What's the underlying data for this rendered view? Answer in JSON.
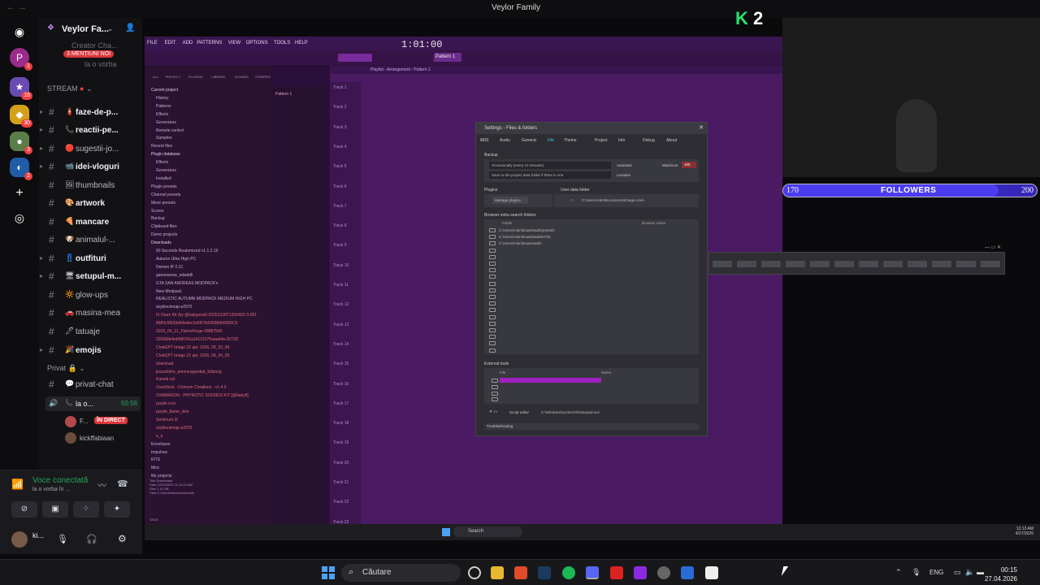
{
  "window": {
    "title": "Veylor Family",
    "nav": "← →"
  },
  "rail": {
    "badges": [
      "1",
      "16",
      "30",
      "3",
      "2"
    ]
  },
  "server": {
    "name": "Veylor Fa...",
    "mention_banner": "3 MENȚIUNI NOI",
    "hidden_top": [
      "Creator Cha...",
      "la o vorba"
    ]
  },
  "categories": {
    "stream": "STREAM",
    "private": "Privat"
  },
  "channels": [
    {
      "name": "faze-de-p...",
      "emoji": "🧯",
      "bold": true
    },
    {
      "name": "reactii-pe...",
      "emoji": "📞",
      "bold": true
    },
    {
      "name": "sugestii-jo...",
      "emoji": "🔴",
      "bold": false
    },
    {
      "name": "idei-vloguri",
      "emoji": "📹",
      "bold": true
    },
    {
      "name": "thumbnails",
      "emoji": "🖼",
      "bold": false
    },
    {
      "name": "artwork",
      "emoji": "🎨",
      "bold": true
    },
    {
      "name": "mancare",
      "emoji": "🍕",
      "bold": true
    },
    {
      "name": "animalul-...",
      "emoji": "🐶",
      "bold": false
    },
    {
      "name": "outfituri",
      "emoji": "👖",
      "bold": true
    },
    {
      "name": "setupul-m...",
      "emoji": "🖥",
      "bold": true
    },
    {
      "name": "glow-ups",
      "emoji": "🔆",
      "bold": false
    },
    {
      "name": "masina-mea",
      "emoji": "🚗",
      "bold": false
    },
    {
      "name": "tatuaje",
      "emoji": "🖊",
      "bold": false
    },
    {
      "name": "emojis",
      "emoji": "🎉",
      "bold": true
    }
  ],
  "private_channels": [
    {
      "name": "privat-chat",
      "emoji": "💬"
    },
    {
      "name": "la o...",
      "emoji": "📞",
      "time": "50:56"
    }
  ],
  "voice_users": [
    {
      "name": "F...",
      "badge": "ÎN DIRECT"
    },
    {
      "name": "kickffabiaan"
    }
  ],
  "voice_panel": {
    "status": "Voce conectată",
    "channel": "la o vorba în ...",
    "user": "ki..."
  },
  "fl": {
    "menu": [
      "FILE",
      "EDIT",
      "ADD",
      "PATTERNS",
      "VIEW",
      "OPTIONS",
      "TOOLS",
      "HELP"
    ],
    "time": "1:01:00",
    "pattern": "Pattern 1",
    "browser_tabs": [
      "ALL",
      "PROJECT",
      "PLUGINS",
      "LIBRARY",
      "SOUNDS",
      "STARRED"
    ],
    "browser_items": [
      {
        "t": "Current project",
        "sel": true
      },
      {
        "t": "History"
      },
      {
        "t": "Patterns"
      },
      {
        "t": "Effects"
      },
      {
        "t": "Generators"
      },
      {
        "t": "Remote control"
      },
      {
        "t": "Samples"
      },
      {
        "t": "Recent files"
      },
      {
        "t": "Plugin database",
        "sel": true
      },
      {
        "t": "Effects"
      },
      {
        "t": "Generators"
      },
      {
        "t": "Installed"
      },
      {
        "t": "Plugin presets"
      },
      {
        "t": "Channel presets"
      },
      {
        "t": "Mixer presets"
      },
      {
        "t": "Scores"
      },
      {
        "t": "Backup"
      },
      {
        "t": "Clipboard files"
      },
      {
        "t": "Demo projects"
      },
      {
        "t": "Downloads",
        "sel": true
      },
      {
        "t": "60 Seconds Reatomized v1.1.2.16"
      },
      {
        "t": "Autumn Ultra High PC"
      },
      {
        "t": "Demon IP 2.21"
      },
      {
        "t": "gamesense_sdwddll"
      },
      {
        "t": "GTA SAN ANDREAS MODPACK's"
      },
      {
        "t": "New Modpack"
      },
      {
        "t": "REALISTIC AUTUMN MODPACK MEDIUM HIGH PC"
      },
      {
        "t": "skyblockmap-e2970"
      },
      {
        "t": "IX Drum Kit (by @babyprod)-20251228T125040Z-3-001",
        "red": true
      },
      {
        "t": "8989c5fb39d49edec1b6f07b4369b5b5665C5",
        "red": true
      },
      {
        "t": "2026_04_21_FlameForge-28887560",
        "red": true
      },
      {
        "t": "32668defed486741a14121975aaad4a-2572D",
        "red": true
      },
      {
        "t": "ChatGPT Image 22 apr. 2026, 09_33_49",
        "red": true
      },
      {
        "t": "ChatGPT Image 22 apr. 2026, 09_34_59",
        "red": true
      },
      {
        "t": "download",
        "red": true
      },
      {
        "t": "jesusdisho_amoneyigeebat_fullsong",
        "red": true
      },
      {
        "t": "Kaneki cal",
        "red": true
      },
      {
        "t": "Overblock - Crimson Creations - v1.4.3",
        "red": true
      },
      {
        "t": "OXAMASON - PHYNOTIC SOUNDS KIT [@babyfi]",
        "red": true
      },
      {
        "t": "purple icon",
        "red": true
      },
      {
        "t": "purple_flame_skin",
        "red": true
      },
      {
        "t": "Semloum IX",
        "red": true
      },
      {
        "t": "skyblockmap-e2970",
        "red": true
      },
      {
        "t": "e_a",
        "red": true
      },
      {
        "t": "Envelopes"
      },
      {
        "t": "Impulses"
      },
      {
        "t": "KITS"
      },
      {
        "t": "Misc"
      },
      {
        "t": "My projects"
      }
    ],
    "info": [
      "Title   Downloads",
      "Date    12/23/2021 11:13:24 AM",
      "Size    1.14 GB",
      "Path    C:\\Users\\Alen\\Downloads"
    ],
    "tags": "TAGS",
    "playlist_title": "Playlist - Arrangement › Pattern 1",
    "tracks": [
      "Track 1",
      "Track 2",
      "Track 3",
      "Track 4",
      "Track 5",
      "Track 6",
      "Track 7",
      "Track 8",
      "Track 9",
      "Track 10",
      "Track 11",
      "Track 12",
      "Track 13",
      "Track 14",
      "Track 15",
      "Track 16",
      "Track 17",
      "Track 18",
      "Track 19",
      "Track 20",
      "Track 21",
      "Track 22",
      "Track 23"
    ]
  },
  "dialog": {
    "title": "Settings - Files & folders",
    "tabs": [
      "MIDI",
      "Audio",
      "General",
      "File",
      "Theme",
      "Project",
      "Info",
      "Debug",
      "About"
    ],
    "backup_label": "Backup",
    "backup_freq": "Occasionally (every 10 minutes)",
    "backup_loc": "Save to the project data folder if there is one",
    "autosave": "Autosave",
    "location": "Location",
    "maximum": "Maximum",
    "max_value": "100",
    "plugins_label": "Plugins",
    "manage_plugins": "Manage plugins",
    "user_data_label": "User data folder",
    "user_data_path": "C:\\Users\\Alen\\Documents\\Image-Line\\",
    "extra_label": "Browser extra search folders",
    "col_folder": "Folder",
    "col_browser": "Browser name",
    "folders": [
      "C:\\Users\\Alen\\Downloads\\presets\\",
      "C:\\Users\\Alen\\Downloads\\KITS\\",
      "C:\\Users\\Alen\\Downloads\\"
    ],
    "external_label": "External tools",
    "col_file": "File",
    "col_name": "Name",
    "script_editor": "Script editor",
    "script_path": "C:\\Windows\\System32\\Notepad.exe",
    "troubleshooting": "Troubleshooting"
  },
  "overlay": {
    "k2_k": "K",
    "k2_num": "2",
    "followers_current": "170",
    "followers_label": "FOLLOWERS",
    "followers_goal": "200",
    "followers_progress": 0.85
  },
  "streamed_taskbar": {
    "search": "Search",
    "time": "12:13 AM",
    "date": "4/27/2026"
  },
  "taskbar": {
    "search_label": "Căutare",
    "lang": "ENG",
    "time": "00:15",
    "date": "27.04.2026"
  }
}
